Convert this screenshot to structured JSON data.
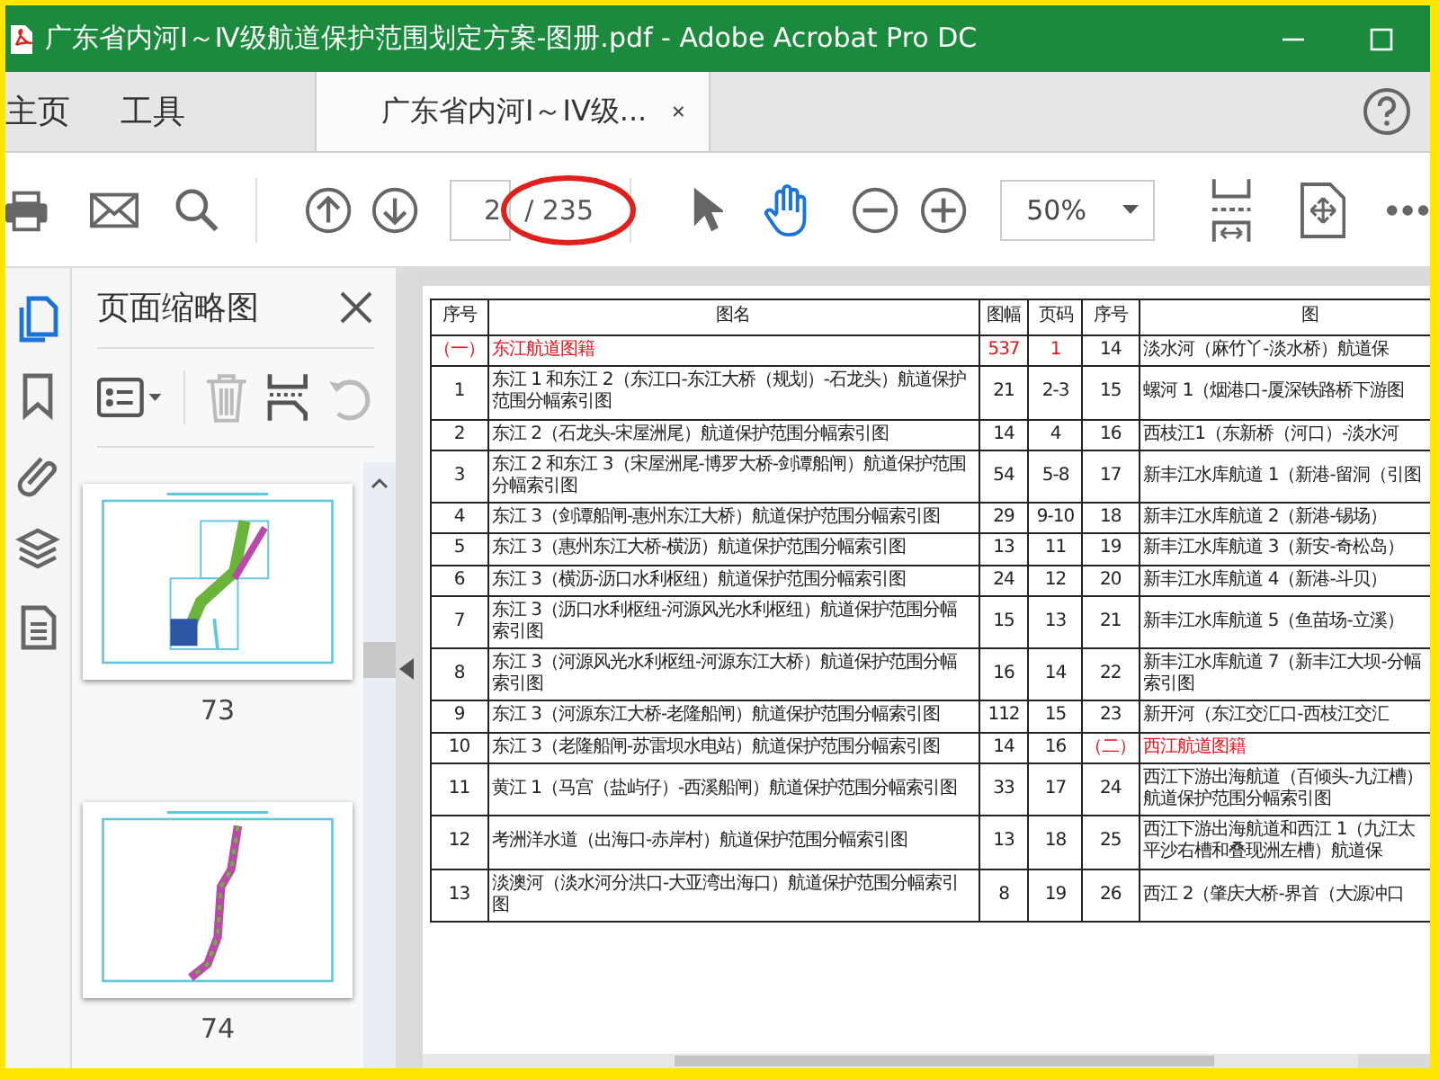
{
  "window": {
    "title": "广东省内河Ⅰ～Ⅳ级航道保护范围划定方案-图册.pdf - Adobe Acrobat Pro DC"
  },
  "tabs": [
    {
      "label": "主页",
      "selected": false,
      "kind": "home"
    },
    {
      "label": "工具",
      "selected": false,
      "kind": "tools"
    },
    {
      "label": "广东省内河I～IV级...",
      "selected": true,
      "kind": "document"
    }
  ],
  "toolbar": {
    "page_field": {
      "value": "2"
    },
    "page_total": "/ 235",
    "tools": [
      {
        "kind": "select",
        "selected": false
      },
      {
        "kind": "hand",
        "selected": true
      }
    ],
    "zoom": {
      "value": "50%"
    }
  },
  "sidebar": {
    "items": [
      {
        "kind": "pages",
        "selected": true
      },
      {
        "kind": "bookmarks",
        "selected": false
      },
      {
        "kind": "attachments",
        "selected": false
      },
      {
        "kind": "layers",
        "selected": false
      },
      {
        "kind": "document",
        "selected": false
      }
    ]
  },
  "thumbnail_panel": {
    "title": "页面缩略图",
    "tools": [
      {
        "kind": "options",
        "disabled": false
      },
      {
        "kind": "delete",
        "disabled": true
      },
      {
        "kind": "extract",
        "disabled": false
      },
      {
        "kind": "rotate",
        "disabled": true
      }
    ],
    "pages": [
      {
        "label": "73",
        "kind": "wide"
      },
      {
        "label": "74",
        "kind": "narrow"
      }
    ]
  },
  "table": {
    "columns": [
      "序号",
      "图名",
      "图幅",
      "页码",
      "序号",
      "图"
    ],
    "rows": [
      {
        "left": {
          "kind": "section",
          "cells": [
            "（一）",
            "东江航道图籍",
            "537",
            "1"
          ]
        },
        "right": {
          "kind": "item",
          "cells": [
            "14",
            "淡水河（麻竹丫-淡水桥）航道保"
          ]
        }
      },
      {
        "left": {
          "kind": "item",
          "cells": [
            "1",
            "东江 1 和东江 2（东江口-东江大桥（规划）-石龙头）航道保护范围分幅索引图",
            "21",
            "2-3"
          ]
        },
        "right": {
          "kind": "item",
          "cells": [
            "15",
            "螺河 1（烟港口-厦深铁路桥下游图"
          ]
        }
      },
      {
        "left": {
          "kind": "item",
          "cells": [
            "2",
            "东江 2（石龙头-宋屋洲尾）航道保护范围分幅索引图",
            "14",
            "4"
          ]
        },
        "right": {
          "kind": "item",
          "cells": [
            "16",
            "西枝江1（东新桥（河口）-淡水河"
          ]
        }
      },
      {
        "left": {
          "kind": "item",
          "cells": [
            "3",
            "东江 2 和东江 3（宋屋洲尾-博罗大桥-剑谭船闸）航道保护范围分幅索引图",
            "54",
            "5-8"
          ]
        },
        "right": {
          "kind": "item",
          "cells": [
            "17",
            "新丰江水库航道 1（新港-留洞（引图"
          ]
        }
      },
      {
        "left": {
          "kind": "item",
          "cells": [
            "4",
            "东江 3（剑谭船闸-惠州东江大桥）航道保护范围分幅索引图",
            "29",
            "9-10"
          ]
        },
        "right": {
          "kind": "item",
          "cells": [
            "18",
            "新丰江水库航道 2（新港-锡场）"
          ]
        }
      },
      {
        "left": {
          "kind": "item",
          "cells": [
            "5",
            "东江 3（惠州东江大桥-横沥）航道保护范围分幅索引图",
            "13",
            "11"
          ]
        },
        "right": {
          "kind": "item",
          "cells": [
            "19",
            "新丰江水库航道 3（新安-奇松岛）"
          ]
        }
      },
      {
        "left": {
          "kind": "item",
          "cells": [
            "6",
            "东江 3（横沥-沥口水利枢纽）航道保护范围分幅索引图",
            "24",
            "12"
          ]
        },
        "right": {
          "kind": "item",
          "cells": [
            "20",
            "新丰江水库航道 4（新港-斗贝）"
          ]
        }
      },
      {
        "left": {
          "kind": "item",
          "cells": [
            "7",
            "东江 3（沥口水利枢纽-河源风光水利枢纽）航道保护范围分幅索引图",
            "15",
            "13"
          ]
        },
        "right": {
          "kind": "item",
          "cells": [
            "21",
            "新丰江水库航道 5（鱼苗场-立溪）"
          ]
        }
      },
      {
        "left": {
          "kind": "item",
          "cells": [
            "8",
            "东江 3（河源风光水利枢纽-河源东江大桥）航道保护范围分幅索引图",
            "16",
            "14"
          ]
        },
        "right": {
          "kind": "item",
          "cells": [
            "22",
            "新丰江水库航道 7（新丰江大坝-分幅索引图"
          ]
        }
      },
      {
        "left": {
          "kind": "item",
          "cells": [
            "9",
            "东江 3（河源东江大桥-老隆船闸）航道保护范围分幅索引图",
            "112",
            "15"
          ]
        },
        "right": {
          "kind": "item",
          "cells": [
            "23",
            "新开河（东江交汇口-西枝江交汇"
          ]
        }
      },
      {
        "left": {
          "kind": "item",
          "cells": [
            "10",
            "东江 3（老隆船闸-苏雷坝水电站）航道保护范围分幅索引图",
            "14",
            "16"
          ]
        },
        "right": {
          "kind": "section",
          "cells": [
            "（二）",
            "西江航道图籍"
          ]
        }
      },
      {
        "left": {
          "kind": "item",
          "cells": [
            "11",
            "黄江 1（马宫（盐屿仔）-西溪船闸）航道保护范围分幅索引图",
            "33",
            "17"
          ]
        },
        "right": {
          "kind": "item",
          "cells": [
            "24",
            "西江下游出海航道（百倾头-九江槽）航道保护范围分幅索引图"
          ]
        }
      },
      {
        "left": {
          "kind": "item",
          "cells": [
            "12",
            "考洲洋水道（出海口-赤岸村）航道保护范围分幅索引图",
            "13",
            "18"
          ]
        },
        "right": {
          "kind": "item",
          "cells": [
            "25",
            "西江下游出海航道和西江 1（九江太平沙右槽和叠现洲左槽）航道保"
          ]
        }
      },
      {
        "left": {
          "kind": "item",
          "cells": [
            "13",
            "淡澳河（淡水河分洪口-大亚湾出海口）航道保护范围分幅索引图",
            "8",
            "19"
          ]
        },
        "right": {
          "kind": "item",
          "cells": [
            "26",
            "西江 2（肇庆大桥-界首（大源冲口"
          ]
        }
      }
    ]
  }
}
